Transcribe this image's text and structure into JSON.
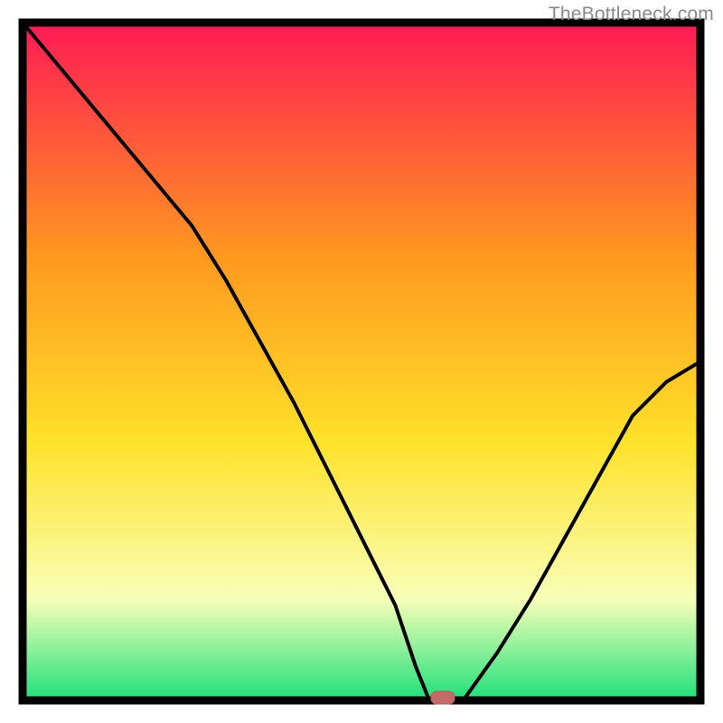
{
  "watermark": "TheBottleneck.com",
  "colors": {
    "frame": "#000000",
    "curve": "#000000",
    "marker_fill": "#c46a6a",
    "marker_stroke": "#b45a5a",
    "gradient_top": "#ff1a55",
    "gradient_mid1": "#ff9a1f",
    "gradient_mid2": "#ffe22a",
    "gradient_low": "#f8ffb8",
    "gradient_bottom": "#1fe07a"
  },
  "chart_data": {
    "type": "line",
    "title": "",
    "xlabel": "",
    "ylabel": "",
    "xlim": [
      0,
      100
    ],
    "ylim": [
      0,
      100
    ],
    "x": [
      0,
      5,
      10,
      15,
      20,
      25,
      30,
      35,
      40,
      45,
      50,
      55,
      58,
      60,
      62,
      65,
      70,
      75,
      80,
      85,
      90,
      95,
      100
    ],
    "values": [
      100,
      94,
      88,
      82,
      76,
      70,
      62,
      53,
      44,
      34,
      24,
      14,
      5,
      0,
      0,
      0,
      7,
      15,
      24,
      33,
      42,
      47,
      50
    ],
    "flat_zone": {
      "x_start": 58,
      "x_end": 65,
      "y": 0
    },
    "marker": {
      "x": 62,
      "y": 0
    }
  }
}
